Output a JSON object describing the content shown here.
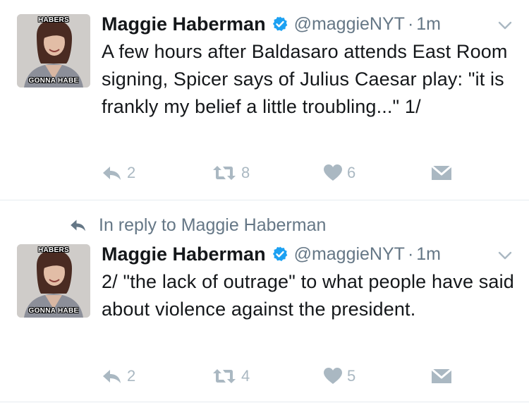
{
  "tweets": [
    {
      "avatar": {
        "top_caption": "HABERS",
        "bottom_caption": "GONNA HABE"
      },
      "name": "Maggie Haberman",
      "handle": "@maggieNYT",
      "separator": "·",
      "time": "1m",
      "text": "A few hours after Baldasaro attends East Room signing, Spicer says of Julius Caesar play: \"it is frankly my belief a little troubling...\" 1/",
      "replies": "2",
      "retweets": "8",
      "likes": "6"
    },
    {
      "avatar": {
        "top_caption": "HABERS",
        "bottom_caption": "GONNA HABE"
      },
      "name": "Maggie Haberman",
      "handle": "@maggieNYT",
      "separator": "·",
      "time": "1m",
      "text": "2/  \"the lack of outrage\" to what people have said about violence against the president.",
      "replies": "2",
      "retweets": "4",
      "likes": "5"
    }
  ],
  "reply_context": "In reply to Maggie Haberman",
  "icons": {
    "verified": "verified-badge-icon",
    "caret": "chevron-down-icon",
    "reply": "reply-icon",
    "retweet": "retweet-icon",
    "like": "heart-icon",
    "dm": "direct-message-icon"
  },
  "colors": {
    "verified": "#1da1f2",
    "icon_gray": "#aab8c2",
    "muted_text": "#657786"
  }
}
